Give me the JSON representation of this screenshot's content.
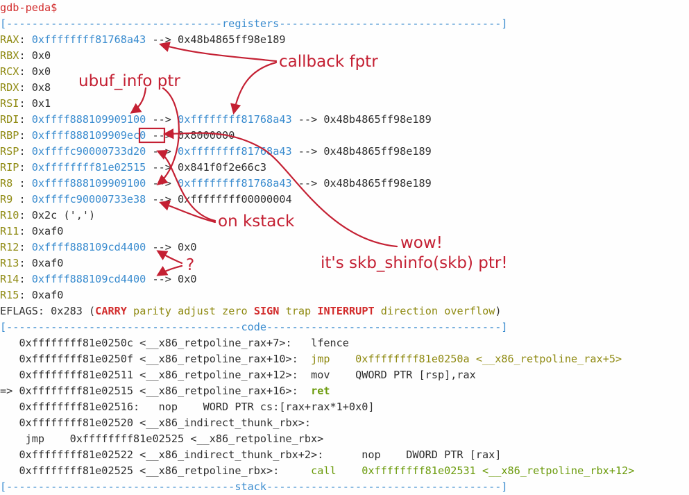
{
  "prompt": "gdb-peda$",
  "sections": {
    "registers": "registers",
    "code": "code",
    "stack": "stack"
  },
  "registers": [
    {
      "name": "RAX",
      "value": "0xffffffff81768a43",
      "chain": [
        {
          "arrow": "-->",
          "value": "0x48b4865ff98e189"
        }
      ]
    },
    {
      "name": "RBX",
      "value": "0x0"
    },
    {
      "name": "RCX",
      "value": "0x0"
    },
    {
      "name": "RDX",
      "value": "0x8"
    },
    {
      "name": "RSI",
      "value": "0x1"
    },
    {
      "name": "RDI",
      "value": "0xffff888109909100",
      "chain": [
        {
          "arrow": "-->",
          "value": "0xffffffff81768a43"
        },
        {
          "arrow": "-->",
          "value": "0x48b4865ff98e189"
        }
      ]
    },
    {
      "name": "RBP",
      "value": "0xffff888109909ec0",
      "chain": [
        {
          "arrow": "-->",
          "value": "0x8000000"
        }
      ]
    },
    {
      "name": "RSP",
      "value": "0xffffc90000733d20",
      "chain": [
        {
          "arrow": "-->",
          "value": "0xffffffff81768a43"
        },
        {
          "arrow": "-->",
          "value": "0x48b4865ff98e189"
        }
      ]
    },
    {
      "name": "RIP",
      "value": "0xffffffff81e02515",
      "chain": [
        {
          "arrow": "-->",
          "value": "0x841f0f2e66c3"
        }
      ]
    },
    {
      "name": "R8 ",
      "value": "0xffff888109909100",
      "chain": [
        {
          "arrow": "-->",
          "value": "0xffffffff81768a43"
        },
        {
          "arrow": "-->",
          "value": "0x48b4865ff98e189"
        }
      ]
    },
    {
      "name": "R9 ",
      "value": "0xffffc90000733e38",
      "chain": [
        {
          "arrow": "-->",
          "value": "0xffffffff00000004"
        }
      ]
    },
    {
      "name": "R10",
      "value": "0x2c (',')"
    },
    {
      "name": "R11",
      "value": "0xaf0"
    },
    {
      "name": "R12",
      "value": "0xffff888109cd4400",
      "chain": [
        {
          "arrow": "-->",
          "value": "0x0"
        }
      ]
    },
    {
      "name": "R13",
      "value": "0xaf0"
    },
    {
      "name": "R14",
      "value": "0xffff888109cd4400",
      "chain": [
        {
          "arrow": "-->",
          "value": "0x0"
        }
      ]
    },
    {
      "name": "R15",
      "value": "0xaf0"
    }
  ],
  "eflags": {
    "label": "EFLAGS:",
    "value": "0x283",
    "flags": [
      {
        "name": "CARRY",
        "set": true
      },
      {
        "name": "parity",
        "set": false
      },
      {
        "name": "adjust",
        "set": false
      },
      {
        "name": "zero",
        "set": false
      },
      {
        "name": "SIGN",
        "set": true
      },
      {
        "name": "trap",
        "set": false
      },
      {
        "name": "INTERRUPT",
        "set": true
      },
      {
        "name": "direction",
        "set": false
      },
      {
        "name": "overflow",
        "set": false
      }
    ]
  },
  "code": [
    {
      "marker": "",
      "addr": "0xffffffff81e0250c",
      "sym": "<__x86_retpoline_rax+7>:",
      "gap": "  ",
      "mnem": "lfence",
      "ops": "",
      "style": "plain"
    },
    {
      "marker": "",
      "addr": "0xffffffff81e0250f",
      "sym": "<__x86_retpoline_rax+10>:",
      "gap": " ",
      "mnem": "jmp",
      "ops": "0xffffffff81e0250a <__x86_retpoline_rax+5>",
      "style": "jmp"
    },
    {
      "marker": "",
      "addr": "0xffffffff81e02511",
      "sym": "<__x86_retpoline_rax+12>:",
      "gap": " ",
      "mnem": "mov",
      "ops": "QWORD PTR [rsp],rax",
      "style": "plain"
    },
    {
      "marker": "=> ",
      "addr": "0xffffffff81e02515",
      "sym": "<__x86_retpoline_rax+16>:",
      "gap": " ",
      "mnem": "ret",
      "ops": "",
      "style": "current"
    },
    {
      "marker": "",
      "addr": "0xffffffff81e02516:",
      "sym": "",
      "gap": "  ",
      "mnem": "nop",
      "ops": "WORD PTR cs:[rax+rax*1+0x0]",
      "style": "plain"
    },
    {
      "marker": "",
      "addr": "0xffffffff81e02520",
      "sym": "<__x86_indirect_thunk_rbx>:",
      "gap": "",
      "mnem": "",
      "ops": "",
      "style": "plain"
    },
    {
      "marker": "",
      "addr": "",
      "sym": "",
      "gap": "",
      "mnem": "jmp",
      "ops": "0xffffffff81e02525 <__x86_retpoline_rbx>",
      "style": "wrapped"
    },
    {
      "marker": "",
      "addr": "0xffffffff81e02522",
      "sym": "<__x86_indirect_thunk_rbx+2>:",
      "gap": "     ",
      "mnem": "nop",
      "ops": "DWORD PTR [rax]",
      "style": "plain"
    },
    {
      "marker": "",
      "addr": "0xffffffff81e02525",
      "sym": "<__x86_retpoline_rbx>:",
      "gap": "    ",
      "mnem": "call",
      "ops": "0xffffffff81e02531 <__x86_retpoline_rbx+12>",
      "style": "call"
    }
  ],
  "annotations": {
    "callback": "callback fptr",
    "ubuf": "ubuf_info ptr",
    "kstack": "on kstack",
    "question": "?",
    "wow": "wow!",
    "shinfo": "it's skb_shinfo(skb) ptr!"
  },
  "colors": {
    "prompt": "#d22c2c",
    "register_name": "#8f8a12",
    "pointer": "#3a8ccf",
    "separator": "#3a8ccf",
    "flag_set": "#d22c2c",
    "jump": "#8f8a12",
    "call": "#6a9a0a",
    "annotation": "#c42033"
  }
}
